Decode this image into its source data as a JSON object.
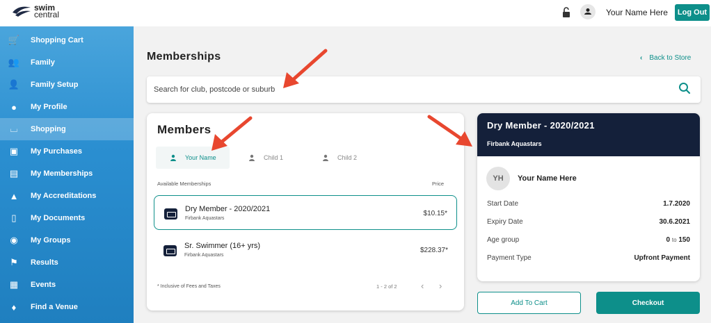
{
  "brand": {
    "line1": "swim",
    "line2": "central"
  },
  "header": {
    "user_name": "Your Name Here",
    "logout_label": "Log Out"
  },
  "sidebar": {
    "items": [
      {
        "label": "Shopping Cart",
        "icon": "cart-icon"
      },
      {
        "label": "Family",
        "icon": "family-icon"
      },
      {
        "label": "Family Setup",
        "icon": "family-setup-icon"
      },
      {
        "label": "My Profile",
        "icon": "profile-icon"
      },
      {
        "label": "Shopping",
        "icon": "basket-icon",
        "active": true
      },
      {
        "label": "My Purchases",
        "icon": "bag-icon"
      },
      {
        "label": "My Memberships",
        "icon": "id-card-icon"
      },
      {
        "label": "My Accreditations",
        "icon": "graduation-cap-icon"
      },
      {
        "label": "My Documents",
        "icon": "document-icon"
      },
      {
        "label": "My Groups",
        "icon": "groups-icon"
      },
      {
        "label": "Results",
        "icon": "flag-icon"
      },
      {
        "label": "Events",
        "icon": "calendar-icon"
      },
      {
        "label": "Find a Venue",
        "icon": "location-pin-icon"
      }
    ]
  },
  "main": {
    "title": "Memberships",
    "back_label": "Back to Store",
    "search_placeholder": "Search for club, postcode or suburb"
  },
  "members": {
    "title": "Members",
    "tabs": [
      {
        "label": "Your Name",
        "active": true
      },
      {
        "label": "Child 1"
      },
      {
        "label": "Child 2"
      }
    ],
    "available_label": "Available Memberships",
    "price_label": "Price",
    "rows": [
      {
        "name": "Dry Member - 2020/2021",
        "club": "Firbank Aquastars",
        "price": "$10.15*",
        "selected": true
      },
      {
        "name": "Sr. Swimmer (16+ yrs)",
        "club": "Firbank Aquastars",
        "price": "$228.37*"
      }
    ],
    "fees_note": "* Inclusive of Fees and Taxes",
    "pager": "1 - 2 of 2"
  },
  "detail": {
    "title": "Dry Member - 2020/2021",
    "club": "Firbank Aquastars",
    "initials": "YH",
    "member_name": "Your Name Here",
    "start_label": "Start Date",
    "start_value": "1.7.2020",
    "expiry_label": "Expiry Date",
    "expiry_value": "30.6.2021",
    "age_label": "Age group",
    "age_from": "0",
    "age_to_word": "to",
    "age_to": "150",
    "payment_label": "Payment Type",
    "payment_value": "Upfront Payment"
  },
  "actions": {
    "add_to_cart": "Add To Cart",
    "checkout": "Checkout"
  },
  "colors": {
    "accent": "#0d8f8a",
    "navy": "#14203a",
    "annotation": "#e8472f"
  }
}
